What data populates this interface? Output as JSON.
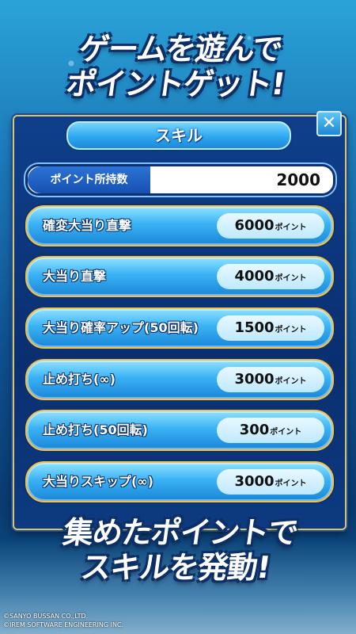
{
  "header": {
    "headline_line1": "ゲームを遊んで",
    "headline_line2": "ポイントゲット!"
  },
  "dialog": {
    "title": "スキル",
    "close_icon": "close-icon",
    "points": {
      "label": "ポイント所持数",
      "value": "2000"
    },
    "unit_label": "ポイント",
    "skills": [
      {
        "name": "確変大当り直撃",
        "cost": "6000"
      },
      {
        "name": "大当り直撃",
        "cost": "4000"
      },
      {
        "name": "大当り確率アップ(50回転)",
        "cost": "1500"
      },
      {
        "name": "止め打ち(∞)",
        "cost": "3000"
      },
      {
        "name": "止め打ち(50回転)",
        "cost": "300"
      },
      {
        "name": "大当りスキップ(∞)",
        "cost": "3000"
      }
    ]
  },
  "footer": {
    "headline_line1": "集めたポイントで",
    "headline_line2": "スキルを発動!",
    "copyright_line1": "©SANYO BUSSAN CO.,LTD.",
    "copyright_line2": "©IREM SOFTWARE ENGINEERING INC."
  },
  "colors": {
    "panel_border": "#d9c46a",
    "skill_border": "#f4c24a",
    "button_blue": "#3ab2f4"
  }
}
